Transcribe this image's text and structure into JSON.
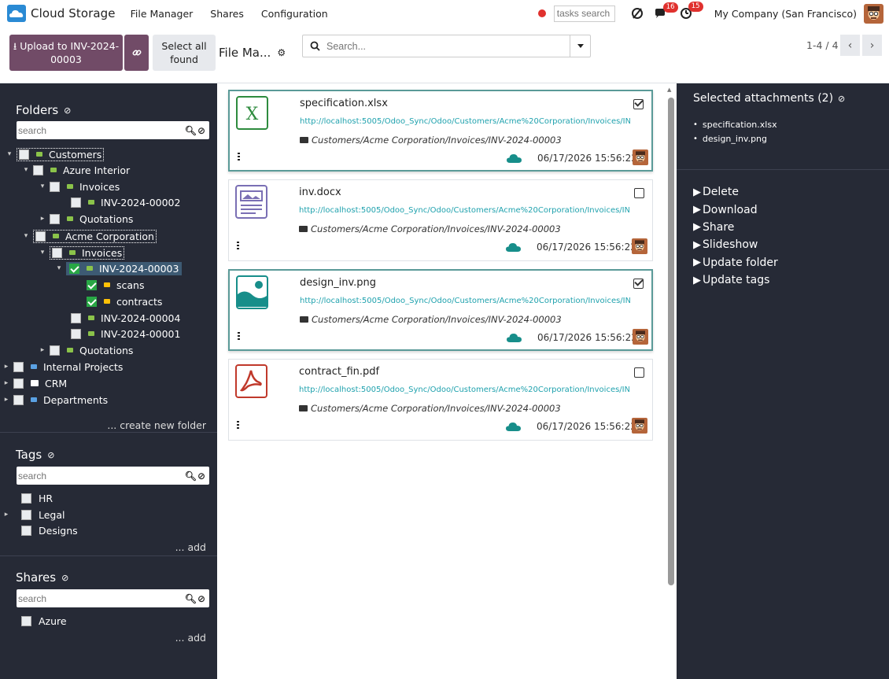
{
  "app": {
    "name": "Cloud Storage"
  },
  "menu": [
    "File Manager",
    "Shares",
    "Configuration"
  ],
  "navbar": {
    "tasks_search_placeholder": "tasks search",
    "messages_count": "16",
    "activities_count": "15",
    "company": "My Company (San Francisco)"
  },
  "toolbar": {
    "upload_label": "Upload to INV-2024-00003",
    "select_all_label": "Select all found",
    "breadcrumb": "File Ma...",
    "search_placeholder": "Search...",
    "pager": "1-4 / 4"
  },
  "folders": {
    "title": "Folders",
    "search_placeholder": "search",
    "create_label": "... create new folder",
    "tree": [
      {
        "label": "Customers",
        "checked": false
      },
      {
        "label": "Azure Interior",
        "checked": false
      },
      {
        "label": "Invoices",
        "checked": false
      },
      {
        "label": "INV-2024-00002",
        "checked": false
      },
      {
        "label": "Quotations",
        "checked": false
      },
      {
        "label": "Acme Corporation",
        "checked": false
      },
      {
        "label": "Invoices",
        "checked": false
      },
      {
        "label": "INV-2024-00003",
        "checked": true
      },
      {
        "label": "scans",
        "checked": true
      },
      {
        "label": "contracts",
        "checked": true
      },
      {
        "label": "INV-2024-00004",
        "checked": false
      },
      {
        "label": "INV-2024-00001",
        "checked": false
      },
      {
        "label": "Quotations",
        "checked": false
      },
      {
        "label": "Internal Projects",
        "checked": false
      },
      {
        "label": "CRM",
        "checked": false
      },
      {
        "label": "Departments",
        "checked": false
      }
    ]
  },
  "tags": {
    "title": "Tags",
    "search_placeholder": "search",
    "items": [
      "HR",
      "Legal",
      "Designs"
    ],
    "add_label": "... add"
  },
  "shares": {
    "title": "Shares",
    "search_placeholder": "search",
    "items": [
      "Azure"
    ],
    "add_label": "... add"
  },
  "attachments": [
    {
      "name": "specification.xlsx",
      "type": "xlsx",
      "selected": true,
      "url": "http://localhost:5005/Odoo_Sync/Odoo/Customers/Acme%20Corporation/Invoices/INV-2024-00003",
      "path": "Customers/Acme Corporation/Invoices/INV-2024-00003",
      "date": "06/17/2026 15:56:22"
    },
    {
      "name": "inv.docx",
      "type": "docx",
      "selected": false,
      "url": "http://localhost:5005/Odoo_Sync/Odoo/Customers/Acme%20Corporation/Invoices/INV-2024-00003",
      "path": "Customers/Acme Corporation/Invoices/INV-2024-00003",
      "date": "06/17/2026 15:56:22"
    },
    {
      "name": "design_inv.png",
      "type": "png",
      "selected": true,
      "url": "http://localhost:5005/Odoo_Sync/Odoo/Customers/Acme%20Corporation/Invoices/INV-2024-00003",
      "path": "Customers/Acme Corporation/Invoices/INV-2024-00003",
      "date": "06/17/2026 15:56:22"
    },
    {
      "name": "contract_fin.pdf",
      "type": "pdf",
      "selected": false,
      "url": "http://localhost:5005/Odoo_Sync/Odoo/Customers/Acme%20Corporation/Invoices/INV-2024-00003",
      "path": "Customers/Acme Corporation/Invoices/INV-2024-00003",
      "date": "06/17/2026 15:56:22"
    }
  ],
  "selection_panel": {
    "title": "Selected attachments (2)",
    "items": [
      "specification.xlsx",
      "design_inv.png"
    ],
    "actions": [
      "Delete",
      "Download",
      "Share",
      "Slideshow",
      "Update folder",
      "Update tags"
    ]
  },
  "colors": {
    "primary": "#714b67",
    "sidebar_bg": "#262a36",
    "link": "#20a2ae",
    "selected_border": "#5a9a98",
    "badge": "#e0312e"
  }
}
